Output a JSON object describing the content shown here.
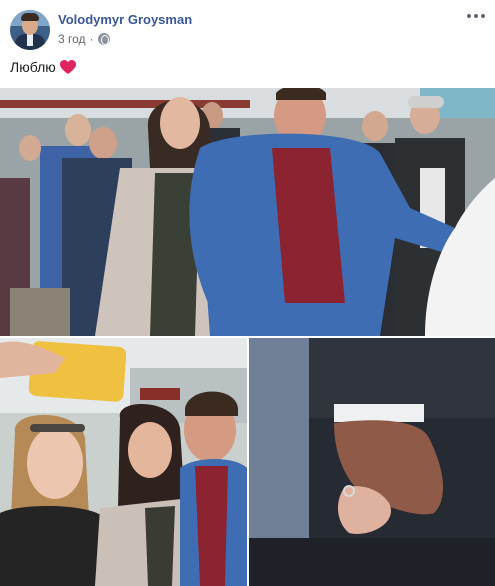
{
  "post": {
    "author": "Volodymyr Groysman",
    "time": "3 год",
    "separator": "·",
    "privacy_icon": "globe-icon",
    "text": "Люблю",
    "emoji": "heart-icon",
    "more_icon": "more-options-icon"
  },
  "colors": {
    "author_link": "#385898",
    "meta_text": "#606770",
    "heart": "#e0245e"
  }
}
